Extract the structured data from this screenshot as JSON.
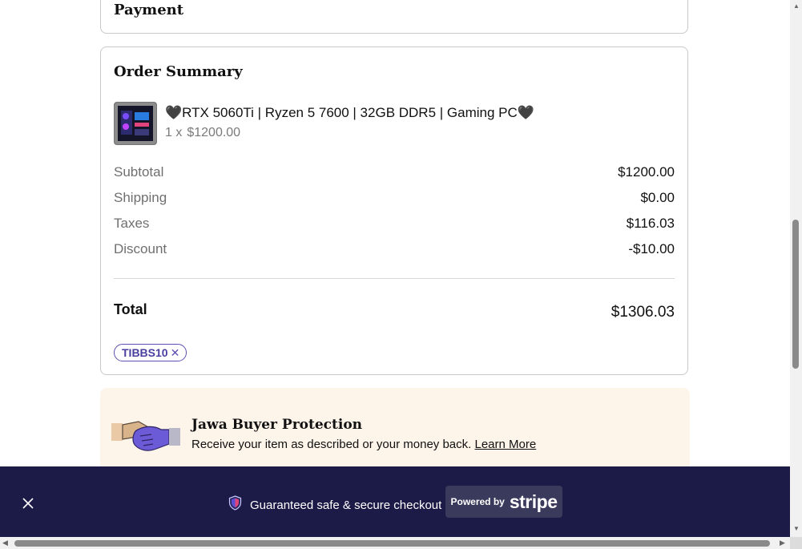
{
  "payment": {
    "heading": "Payment"
  },
  "order_summary": {
    "heading": "Order Summary",
    "product": {
      "name": "🖤RTX 5060Ti | Ryzen 5 7600 | 32GB DDR5 | Gaming PC🖤",
      "quantity": "1 x",
      "price": "$1200.00"
    },
    "lines": [
      {
        "label": "Subtotal",
        "value": "$1200.00"
      },
      {
        "label": "Shipping",
        "value": "$0.00"
      },
      {
        "label": "Taxes",
        "value": "$116.03"
      },
      {
        "label": "Discount",
        "value": "-$10.00"
      }
    ],
    "total_label": "Total",
    "total_value": "$1306.03",
    "discount_code": "TIBBS10"
  },
  "buyer_protection": {
    "title": "Jawa Buyer Protection",
    "text": "Receive your item as described or your money back.",
    "link": "Learn More"
  },
  "secure_bar": {
    "text": "Guaranteed safe & secure checkout",
    "badge_prefix": "Powered by",
    "badge_logo": "stripe"
  },
  "icons": {
    "close": "close-icon",
    "shield": "shield-icon",
    "chip_remove": "remove-icon",
    "handshake": "handshake-icon"
  },
  "colors": {
    "bar_background": "#1c1a47",
    "protection_background": "#fdf4ea",
    "chip_accent": "#5b4fb0"
  }
}
